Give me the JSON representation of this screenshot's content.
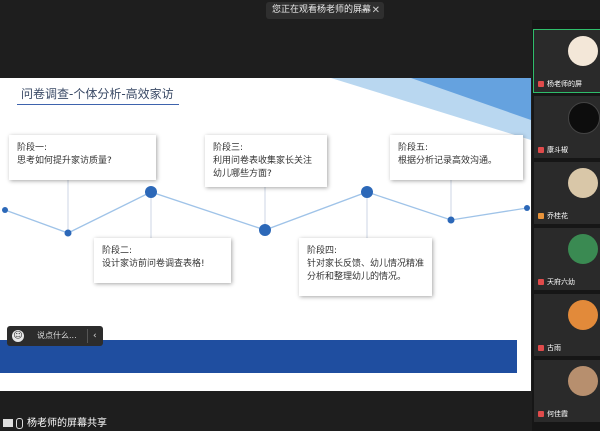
{
  "banner": {
    "text": "您正在观看杨老师的屏幕",
    "close": "✕"
  },
  "slide": {
    "title": "问卷调查-个体分析-高效家访",
    "stages": [
      {
        "label": "阶段一:",
        "text": "思考如何提升家访质量?"
      },
      {
        "label": "阶段二:",
        "text": "设计家访前问卷调查表格!"
      },
      {
        "label": "阶段三:",
        "text": "利用问卷表收集家长关注幼儿哪些方面?"
      },
      {
        "label": "阶段四:",
        "text": "针对家长反馈、幼儿情况精准分析和整理幼儿的情况。"
      },
      {
        "label": "阶段五:",
        "text": "根据分析记录高效沟通。"
      }
    ]
  },
  "chat": {
    "placeholder": "说点什么...",
    "chevron": "‹"
  },
  "share_label": "杨老师的屏幕共享",
  "participants": [
    {
      "name": "杨老师的屏"
    },
    {
      "name": "康斗椒"
    },
    {
      "name": "乔桂花"
    },
    {
      "name": "天府六幼"
    },
    {
      "name": "古雨"
    },
    {
      "name": "何佳霞"
    }
  ],
  "colors": {
    "accent": "#1f4ea0",
    "title": "#3a4a66",
    "node": "#2c68b8",
    "active_border": "#2fbd6b"
  }
}
